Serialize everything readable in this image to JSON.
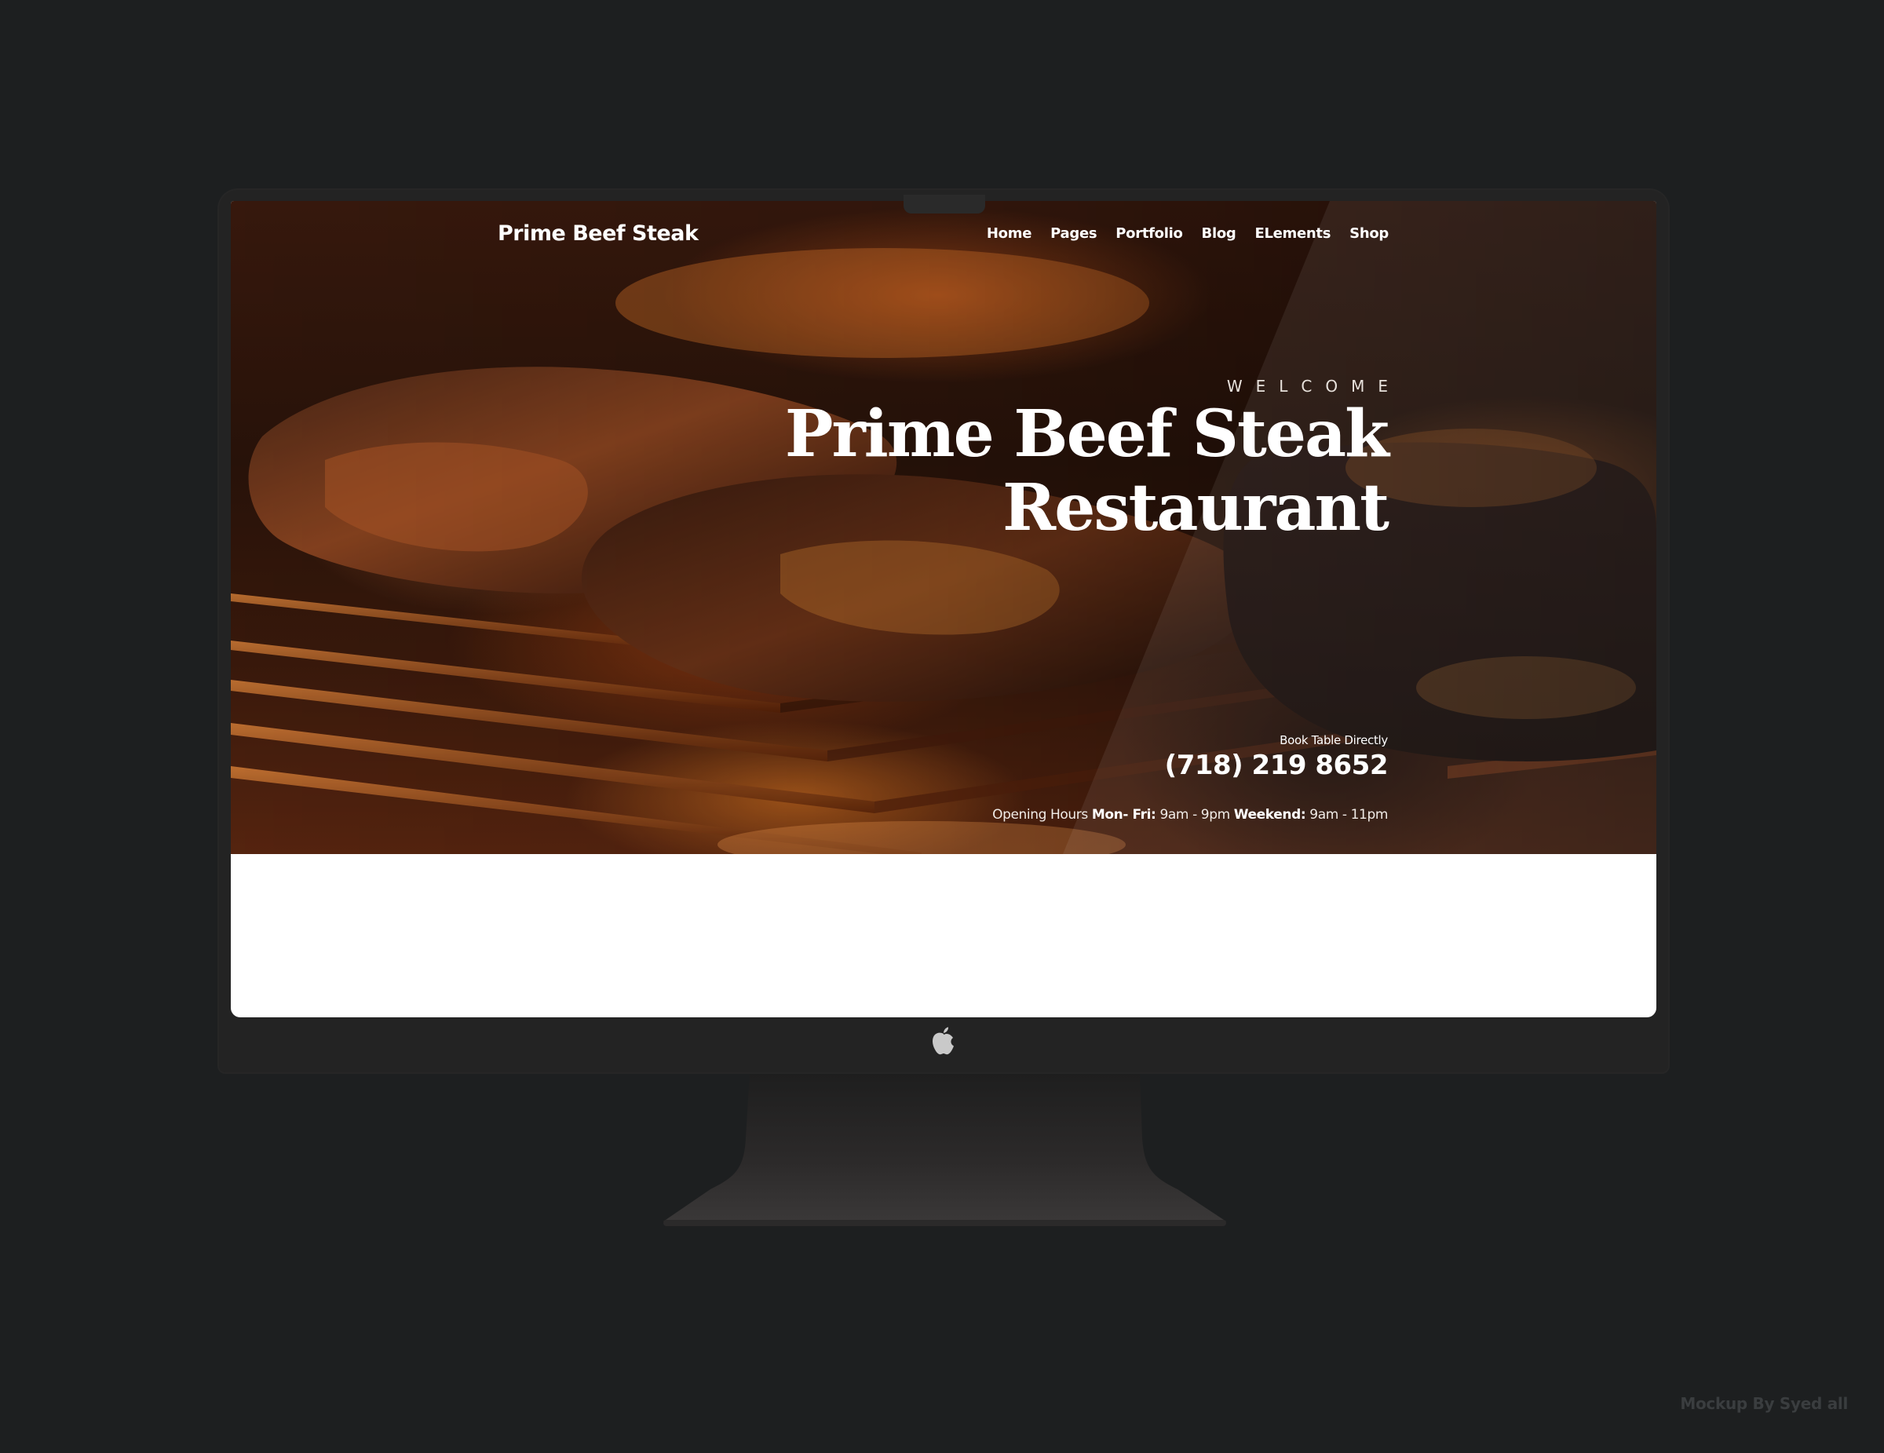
{
  "site": {
    "brand": "Prime Beef Steak",
    "nav": [
      "Home",
      "Pages",
      "Portfolio",
      "Blog",
      "ELements",
      "Shop"
    ]
  },
  "hero": {
    "eyebrow": "WELCOME",
    "title_line1": "Prime Beef Steak",
    "title_line2": "Restaurant",
    "book_label": "Book Table Directly",
    "phone": "(718) 219 8652",
    "hours_label": "Opening Hours",
    "weekday_label": "Mon- Fri:",
    "weekday_hours": "9am - 9pm",
    "weekend_label": "Weekend:",
    "weekend_hours": "9am - 11pm"
  },
  "mockup": {
    "credit": "Mockup By Syed all"
  },
  "colors": {
    "background": "#1d1f20",
    "bezel": "#232323",
    "screen_bottom": "#ffffff",
    "hero_text": "#ffffff",
    "ember": "#e0782a"
  },
  "icons": {
    "monitor_logo": "apple-logo-icon"
  }
}
